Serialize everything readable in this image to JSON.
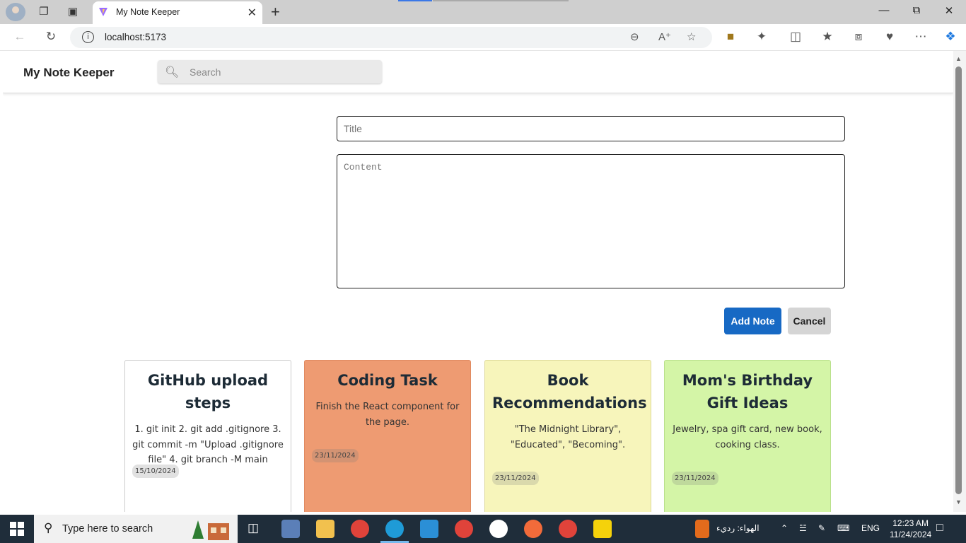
{
  "browser": {
    "tab_title": "My Note Keeper",
    "url": "localhost:5173",
    "zoom_icon": "zoom-out-icon",
    "read_aloud_icon": "read-aloud-icon"
  },
  "app": {
    "title": "My Note Keeper",
    "search_placeholder": "Search"
  },
  "form": {
    "title_placeholder": "Title",
    "content_placeholder": "Content",
    "add_label": "Add Note",
    "cancel_label": "Cancel"
  },
  "notes": [
    {
      "title": "GitHub upload steps",
      "content": "1. git init 2. git add .gitignore 3. git commit -m \"Upload .gitignore file\" 4. git branch -M main",
      "date": "15/10/2024",
      "color": "#ffffff"
    },
    {
      "title": "Coding Task",
      "content": "Finish the React component for the page.",
      "date": "23/11/2024",
      "color": "#ee9b72"
    },
    {
      "title": "Book Recommendations",
      "content": "\"The Midnight Library\", \"Educated\", \"Becoming\".",
      "date": "23/11/2024",
      "color": "#f7f5bb"
    },
    {
      "title": "Mom's Birthday Gift Ideas",
      "content": "Jewelry, spa gift card, new book, cooking class.",
      "date": "23/11/2024",
      "color": "#d4f5a7"
    }
  ],
  "taskbar": {
    "search_text": "Type here to search",
    "weather": "الهواء: رديء",
    "language": "ENG",
    "time": "12:23 AM",
    "date": "11/24/2024"
  }
}
